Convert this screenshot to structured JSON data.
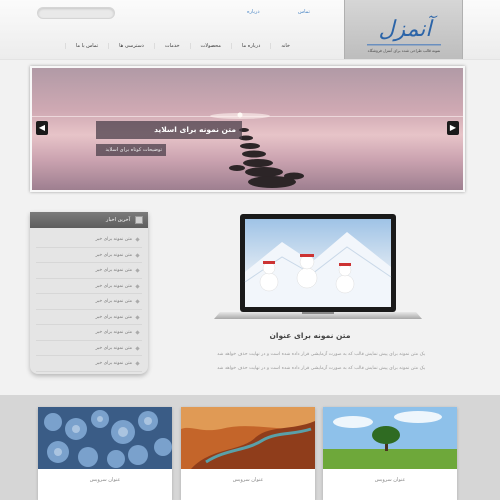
{
  "header": {
    "search_placeholder": "",
    "links": [
      "درباره",
      "تماس"
    ],
    "logo_text": "آنمزل",
    "logo_tagline": "نمونه قالب طراحی شده برای آنمزل فروشگاه"
  },
  "nav": {
    "items": [
      "خانه",
      "درباره ما",
      "محصولات",
      "خدمات",
      "دسترسی ها",
      "تماس با ما"
    ]
  },
  "slider": {
    "title": "متن نمونه برای اسلاید",
    "subtitle": "توضیحات کوتاه برای اسلاید",
    "prev_icon": "chevron-left-icon",
    "next_icon": "chevron-right-icon"
  },
  "sidebar": {
    "title": "آخرین اخبار",
    "items": [
      "متن نمونه برای خبر",
      "متن نمونه برای خبر",
      "متن نمونه برای خبر",
      "متن نمونه برای خبر",
      "متن نمونه برای خبر",
      "متن نمونه برای خبر",
      "متن نمونه برای خبر",
      "متن نمونه برای خبر",
      "متن نمونه برای خبر"
    ]
  },
  "feature": {
    "title": "متن نمونه برای عنوان",
    "lines": [
      "یک متن نمونه برای پیش نمایش قالب که به صورت آزمایشی قرار داده شده است و در نهایت حذف خواهد شد",
      "یک متن نمونه برای پیش نمایش قالب که به صورت آزمایشی قرار داده شده است و در نهایت حذف خواهد شد"
    ]
  },
  "cards": [
    {
      "label": "عنوان سرویس"
    },
    {
      "label": "عنوان سرویس"
    },
    {
      "label": "عنوان سرویس"
    }
  ],
  "colors": {
    "accent": "#4a86c5",
    "sidebar_head": "#666666",
    "band": "#d6d6d6"
  }
}
